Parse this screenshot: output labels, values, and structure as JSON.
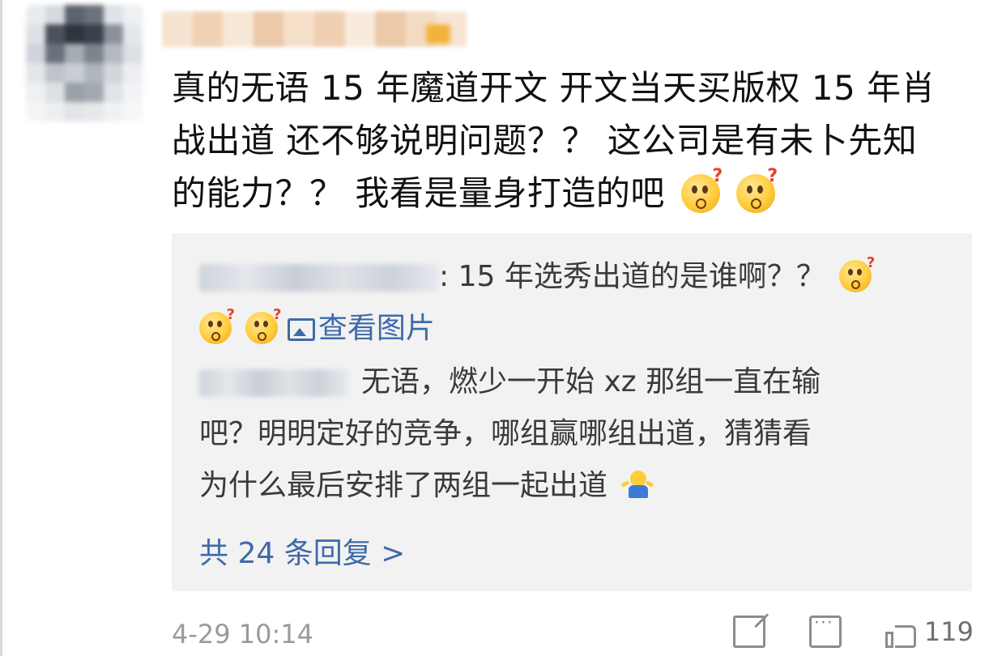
{
  "comment": {
    "text_lines": [
      "真的无语 15 年魔道开文 开文当天买版权 15 年肖",
      "战出道 还不够说明问题？？ 这公司是有未卜先知",
      "的能力？？ 我看是量身打造的吧"
    ],
    "emojis": [
      "thinking-question-emoji",
      "thinking-question-emoji"
    ]
  },
  "replies": [
    {
      "text": ": 15 年选秀出道的是谁啊？？",
      "view_image_label": "查看图片",
      "emojis": [
        "thinking-question-emoji",
        "thinking-question-emoji",
        "thinking-question-emoji"
      ]
    },
    {
      "text_lines": [
        "无语，燃少一开始 xz 那组一直在输",
        "吧？明明定好的竞争，哪组赢哪组出道，猜猜看",
        "为什么最后安排了两组一起出道"
      ],
      "emoji": "shrug-emoji"
    }
  ],
  "more_replies_label": "共 24 条回复 >",
  "footer": {
    "timestamp": "4-29 10:14",
    "like_count": "119"
  },
  "colors": {
    "link": "#3e6aa8",
    "reply_bg": "#f2f2f2",
    "text": "#111111",
    "muted": "#9a9a9a"
  }
}
